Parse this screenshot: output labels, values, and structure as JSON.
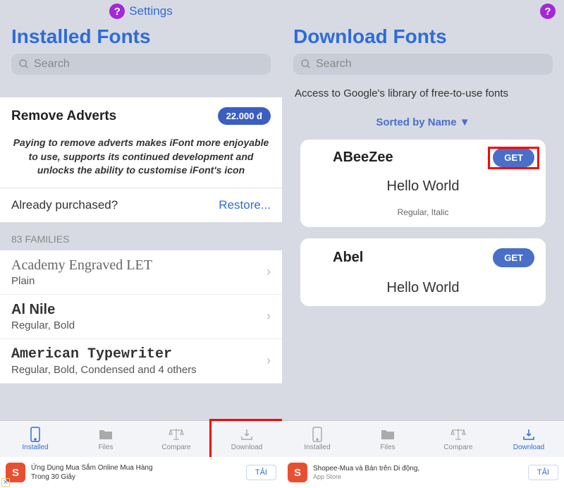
{
  "left": {
    "settings_label": "Settings",
    "page_title": "Installed Fonts",
    "search_placeholder": "Search",
    "remove_adverts_title": "Remove Adverts",
    "price_badge": "22.000 đ",
    "adverts_desc": "Paying to remove adverts makes iFont more enjoyable to use, supports its continued development and unlocks the ability to customise iFont's icon",
    "purchased_label": "Already purchased?",
    "restore_label": "Restore...",
    "section_header": "83 FAMILIES",
    "fonts": [
      {
        "name": "Academy Engraved LET",
        "styles": "Plain"
      },
      {
        "name": "Al Nile",
        "styles": "Regular, Bold"
      },
      {
        "name": "American Typewriter",
        "styles": "Regular, Bold, Condensed and 4 others"
      }
    ],
    "tabs": [
      {
        "label": "Installed"
      },
      {
        "label": "Files"
      },
      {
        "label": "Compare"
      },
      {
        "label": "Download"
      }
    ],
    "ad": {
      "line1": "Ứng Dụng Mua Sắm Online Mua Hàng",
      "line2": "Trong 30 Giây",
      "btn": "TẢI"
    }
  },
  "right": {
    "page_title": "Download Fonts",
    "search_placeholder": "Search",
    "subtitle": "Access to Google's library of free-to-use fonts",
    "sort_label": "Sorted by Name ▼",
    "cards": [
      {
        "name": "ABeeZee",
        "get": "GET",
        "preview": "Hello World",
        "styles": "Regular, Italic"
      },
      {
        "name": "Abel",
        "get": "GET",
        "preview": "Hello World",
        "styles": ""
      }
    ],
    "tabs": [
      {
        "label": "Installed"
      },
      {
        "label": "Files"
      },
      {
        "label": "Compare"
      },
      {
        "label": "Download"
      }
    ],
    "ad": {
      "line1": "Shopee-Mua và Bán trên Di động,",
      "line2": "App Store",
      "btn": "TẢI"
    }
  }
}
